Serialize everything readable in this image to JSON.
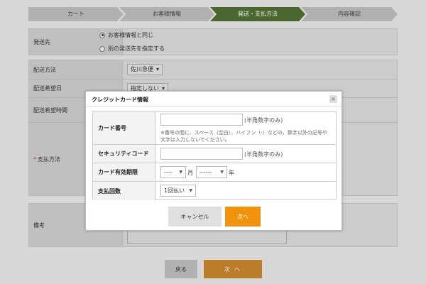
{
  "steps": [
    "カート",
    "お客様情報",
    "発送・支払方法",
    "内容確認"
  ],
  "shipping": {
    "label": "発送先",
    "options": [
      "お客様情報と同じ",
      "別の発送先を指定する"
    ]
  },
  "delivery": {
    "method_label": "配送方法",
    "method_value": "佐川急便",
    "date_label": "配送希望日",
    "date_value": "指定しない",
    "time_label": "配送希望時間"
  },
  "payment": {
    "required_mark": "*",
    "label": "支払方法"
  },
  "memo": {
    "label": "備考"
  },
  "footer": {
    "back_label": "戻る",
    "next_label": "次 へ"
  },
  "modal": {
    "title": "クレジットカード情報",
    "close": "×",
    "card_number_label": "カード番号",
    "card_number_hint": "(半角数字のみ)",
    "card_number_note": "※番号の間に、スペース（空白）、ハイフン（-）などの、数字以外の記号や文字は入力しないでください。",
    "security_label": "セキュリティコード",
    "security_hint": "(半角数字のみ)",
    "expiry_label": "カード有効期限",
    "month_value": "----",
    "month_unit": "月",
    "year_value": "------",
    "year_unit": "年",
    "installments_label": "支払回数",
    "installments_value": "1回払い",
    "cancel_label": "キャンセル",
    "next_label": "次へ"
  },
  "colors": {
    "active_step": "#4f6e34",
    "accent": "#f0920c"
  }
}
